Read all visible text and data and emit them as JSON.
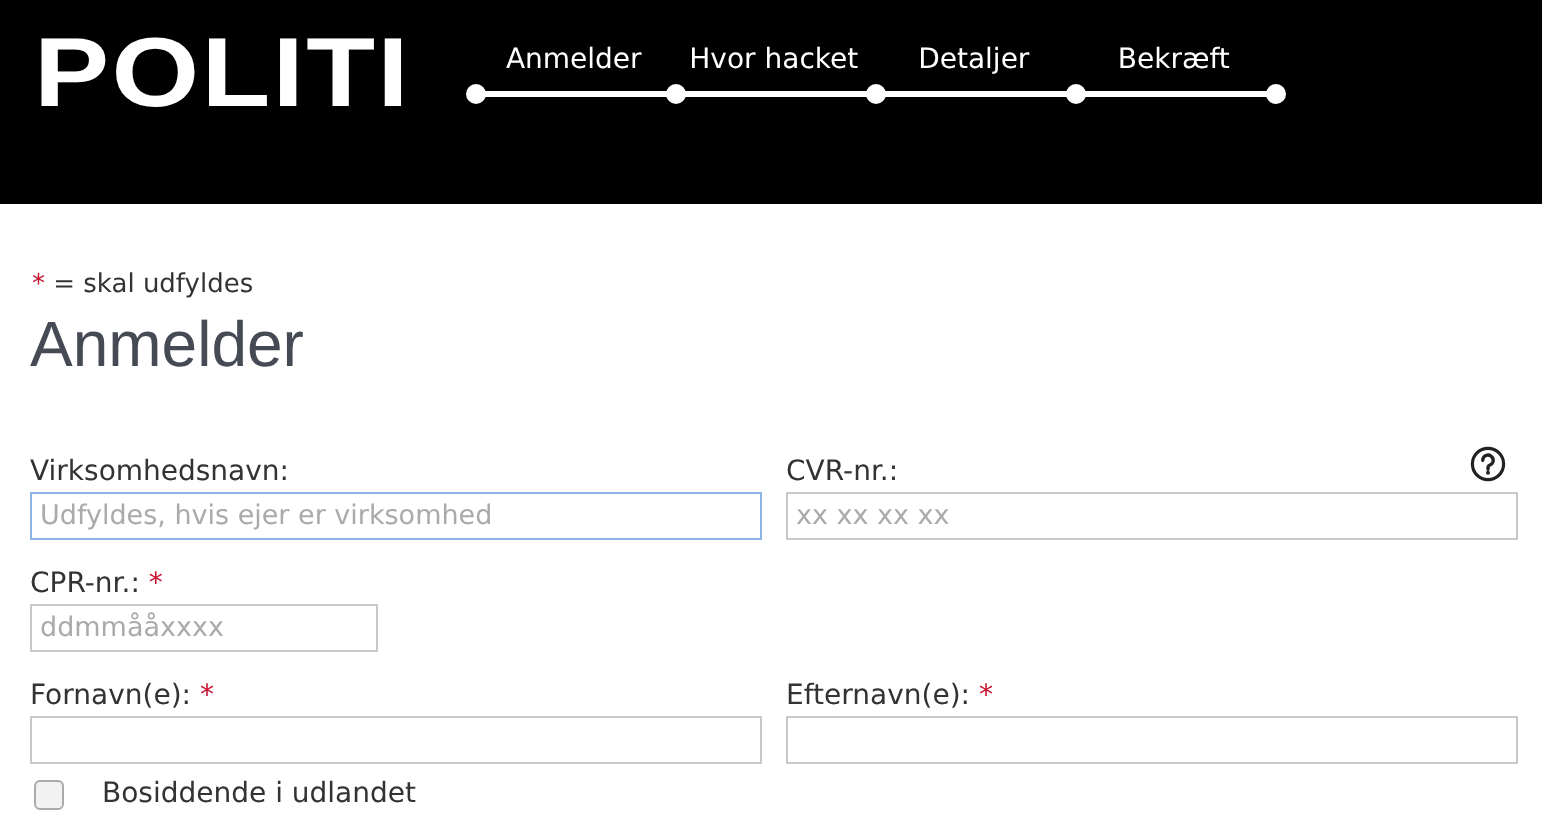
{
  "header": {
    "logo": "POLITI",
    "steps": [
      {
        "label": "Anmelder"
      },
      {
        "label": "Hvor hacket"
      },
      {
        "label": "Detaljer"
      },
      {
        "label": "Bekræft"
      }
    ]
  },
  "legend": {
    "mark": "*",
    "text": "= skal udfyldes"
  },
  "title": "Anmelder",
  "field_rows": [
    {
      "fields": [
        {
          "label": "Virksomhedsnavn:",
          "placeholder": "Udfyldes, hvis ejer er virksomhed",
          "kind": "wide",
          "focused": true
        },
        {
          "label": "CVR-nr.:",
          "placeholder": "xx xx xx xx",
          "kind": "wide",
          "focused": false,
          "help": true
        }
      ]
    },
    {
      "fields": [
        {
          "label": "CPR-nr.:",
          "required_mark": "*",
          "placeholder": "ddmmååxxxx",
          "kind": "short",
          "focused": false
        }
      ]
    },
    {
      "fields": [
        {
          "label": "Fornavn(e):",
          "required_mark": "*",
          "kind": "wide",
          "focused": false
        },
        {
          "label": "Efternavn(e):",
          "required_mark": "*",
          "kind": "wide",
          "focused": false
        }
      ]
    }
  ],
  "checkbox": {
    "label": "Bosiddende i udlandet",
    "checked": false
  }
}
